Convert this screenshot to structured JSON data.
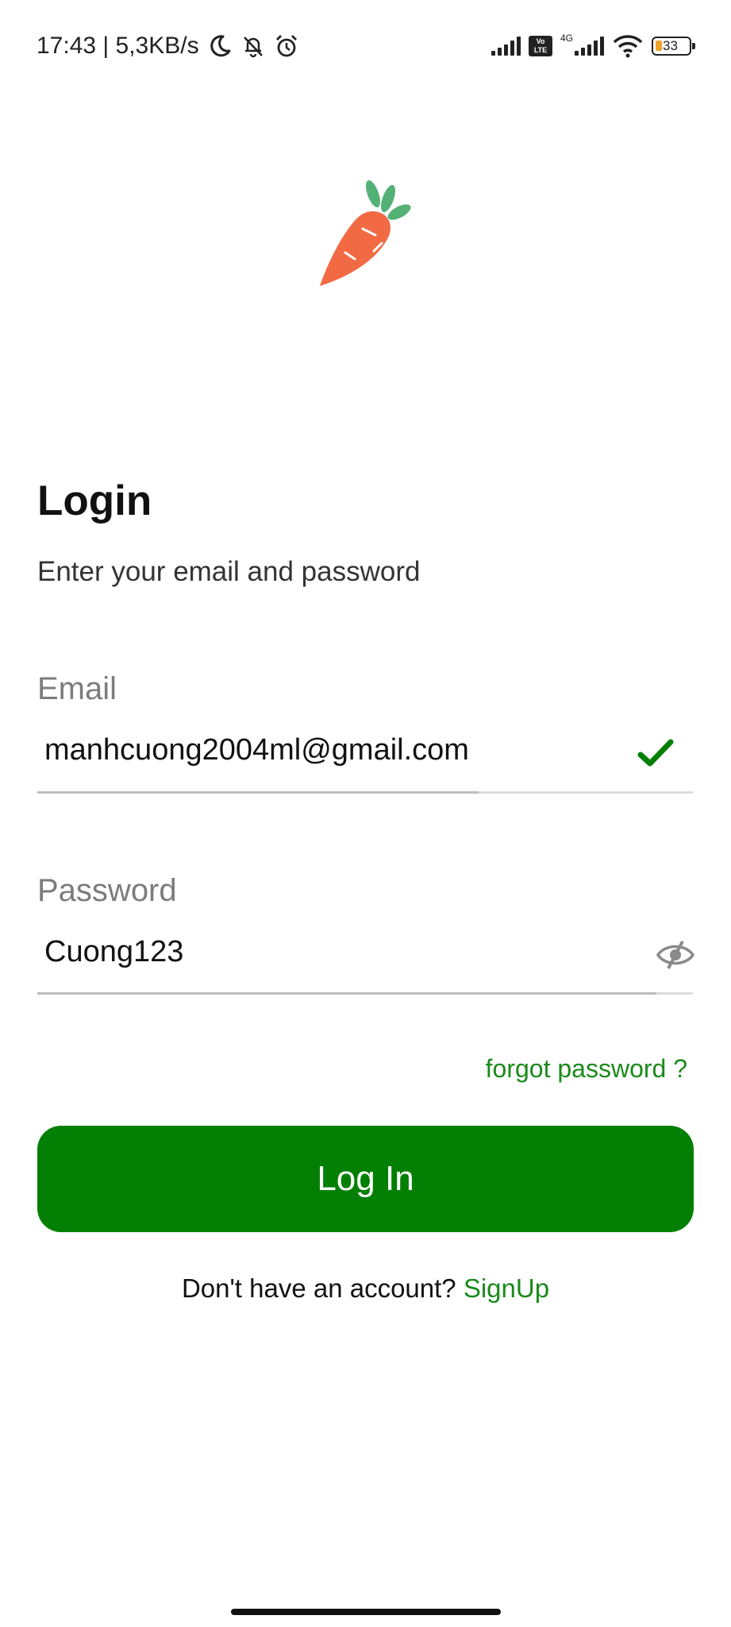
{
  "status_bar": {
    "time_speed": "17:43 | 5,3KB/s",
    "volte_top": "Vo",
    "volte_bottom": "LTE",
    "network": "4G",
    "battery": "33",
    "battery_color": "#f2a12c"
  },
  "login": {
    "title": "Login",
    "subtitle": "Enter your email and password"
  },
  "email": {
    "label": "Email",
    "value": "manhcuong2004ml@gmail.com",
    "status_icon": "check-icon"
  },
  "password": {
    "label": "Password",
    "value": "Cuong123",
    "toggle_icon": "eye-off-icon"
  },
  "forgot_password": "forgot password ?",
  "login_button": "Log In",
  "signup": {
    "prompt": "Don't have an account?",
    "link": "SignUp"
  },
  "colors": {
    "primary_green": "#038003",
    "link_green": "#1a8a1a",
    "carrot_orange": "#f26a43",
    "leaf_green": "#53b175"
  }
}
